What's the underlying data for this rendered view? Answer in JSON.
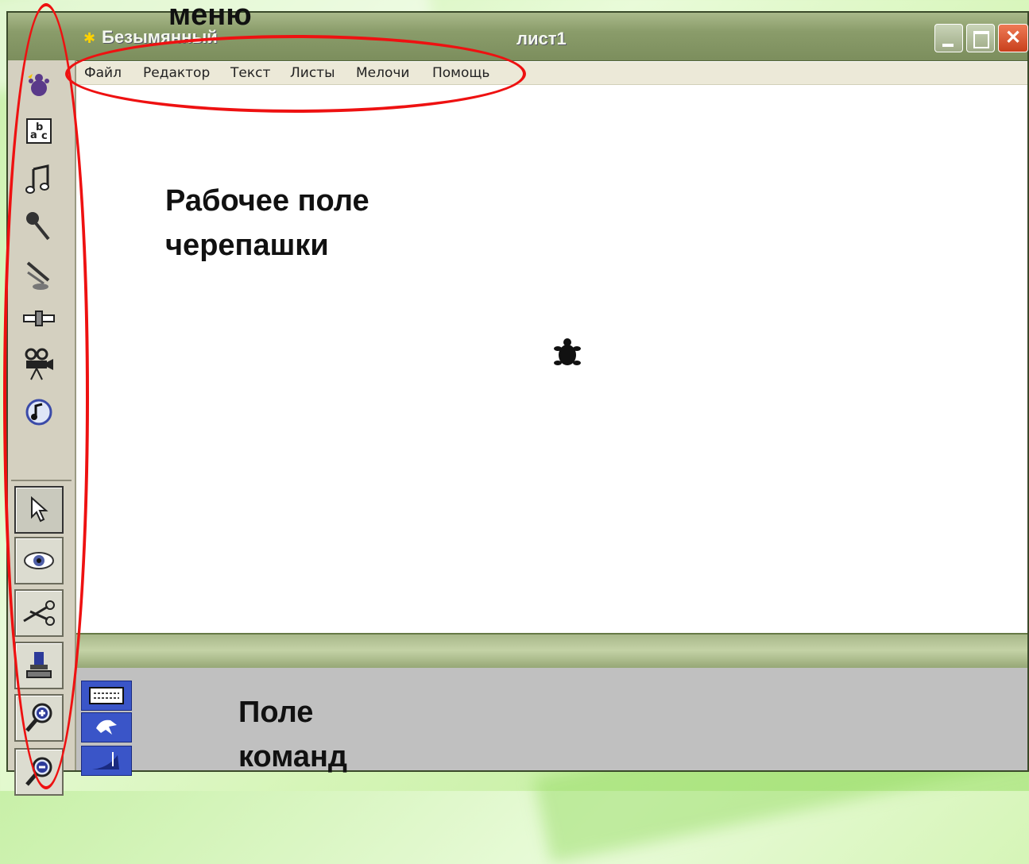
{
  "window": {
    "document_title": "Безымянный",
    "sheet_title": "лист1",
    "buttons": {
      "minimize": "minimize-icon",
      "maximize": "maximize-icon",
      "close": "close-icon"
    }
  },
  "menu": [
    "Файл",
    "Редактор",
    "Текст",
    "Листы",
    "Мелочи",
    "Помощь"
  ],
  "toolbar": {
    "tools": [
      "new-turtle-icon",
      "text-box-icon",
      "melody-icon",
      "microphone-icon",
      "cd-player-icon",
      "slider-icon",
      "video-camera-icon",
      "sound-icon"
    ],
    "modes": [
      "pointer-icon",
      "eye-icon",
      "scissors-icon",
      "stamp-icon",
      "zoom-in-icon",
      "zoom-out-icon"
    ]
  },
  "command_buttons": [
    "command-center-icon",
    "shapes-icon",
    "procedures-icon"
  ],
  "annotations": {
    "menu_label": "меню",
    "canvas_label_line1": "Рабочее поле",
    "canvas_label_line2": "черепашки",
    "commands_label_line1": "Поле",
    "commands_label_line2": "команд",
    "highlight_color": "#ee1111"
  }
}
